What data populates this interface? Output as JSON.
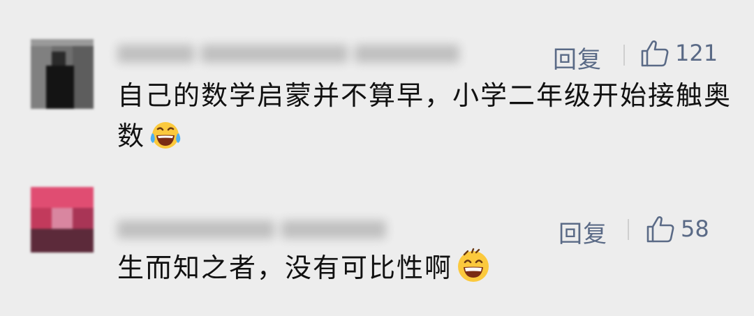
{
  "comments": [
    {
      "reply_label": "回复",
      "like_count": "121",
      "text": "自己的数学启蒙并不算早，小学二年级开始接触奥数",
      "emoji_icon": "laughing-tears-emoji"
    },
    {
      "reply_label": "回复",
      "like_count": "58",
      "text": "生而知之者，没有可比性啊",
      "emoji_icon": "grinning-emoji"
    }
  ],
  "colors": {
    "background": "#ededed",
    "action_text": "#5a6a86",
    "comment_text": "#111111"
  }
}
